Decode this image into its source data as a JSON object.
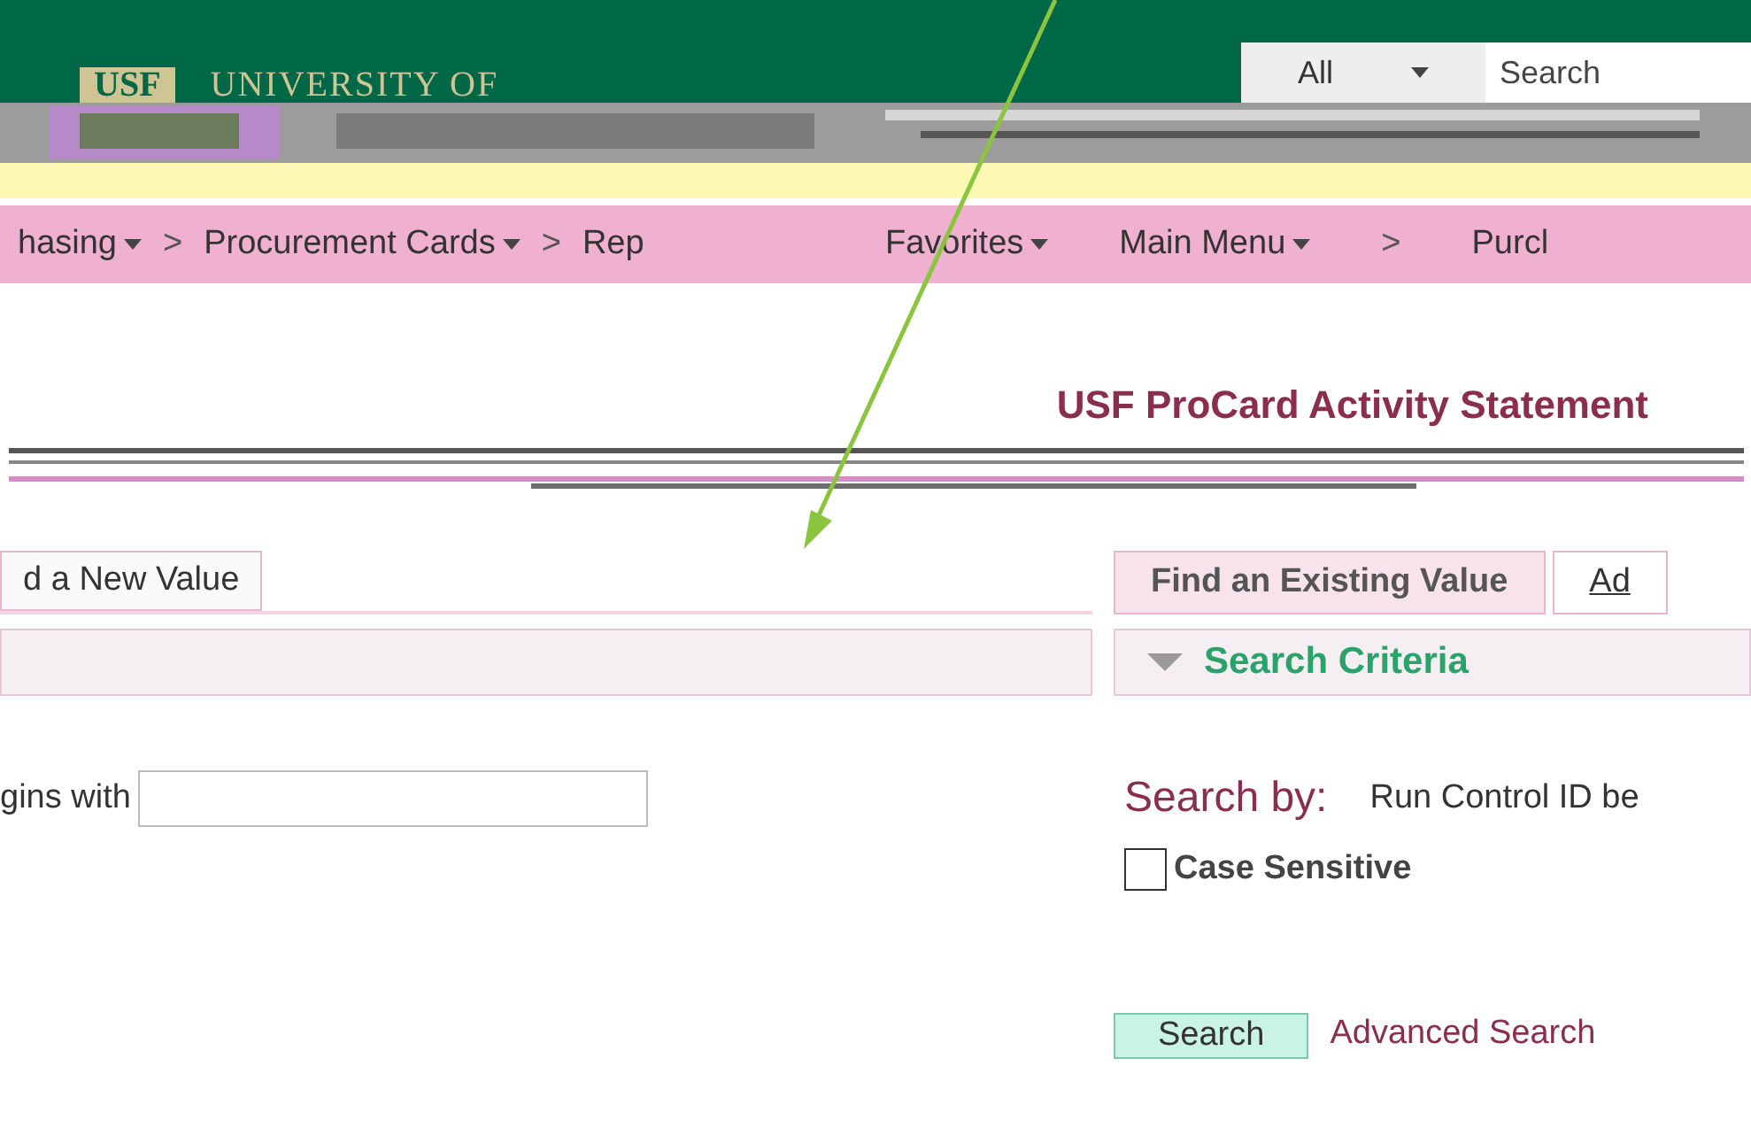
{
  "header": {
    "logo_text": "USF",
    "university": "UNIVERSITY OF",
    "search_scope": "All",
    "search_placeholder": "Search"
  },
  "nav_left": [
    {
      "label": "hasing",
      "kind": "menu"
    },
    {
      "label": ">",
      "kind": "separator"
    },
    {
      "label": "Procurement Cards",
      "kind": "menu"
    },
    {
      "label": ">",
      "kind": "separator"
    },
    {
      "label": "Rep",
      "kind": "link"
    }
  ],
  "nav_right": [
    {
      "label": "Favorites",
      "kind": "menu"
    },
    {
      "label": "Main Menu",
      "kind": "menu"
    },
    {
      "label": ">",
      "kind": "separator"
    },
    {
      "label": "Purcl",
      "kind": "link"
    }
  ],
  "page_title": "USF ProCard Activity Statement",
  "left_tabs": [
    {
      "label": "d a New Value",
      "selected": false
    }
  ],
  "right_tabs": [
    {
      "label": "Find an Existing Value",
      "selected": true
    },
    {
      "label": "Ad",
      "selected": false
    }
  ],
  "section": {
    "title": "Search Criteria",
    "expanded": true
  },
  "left_field": {
    "label": "gins with"
  },
  "search_by": {
    "label": "Search by:",
    "value": "Run Control ID be"
  },
  "case_sensitive": {
    "label": "Case Sensitive",
    "checked": false
  },
  "search_button": "Search",
  "advanced_link": "Advanced Search"
}
